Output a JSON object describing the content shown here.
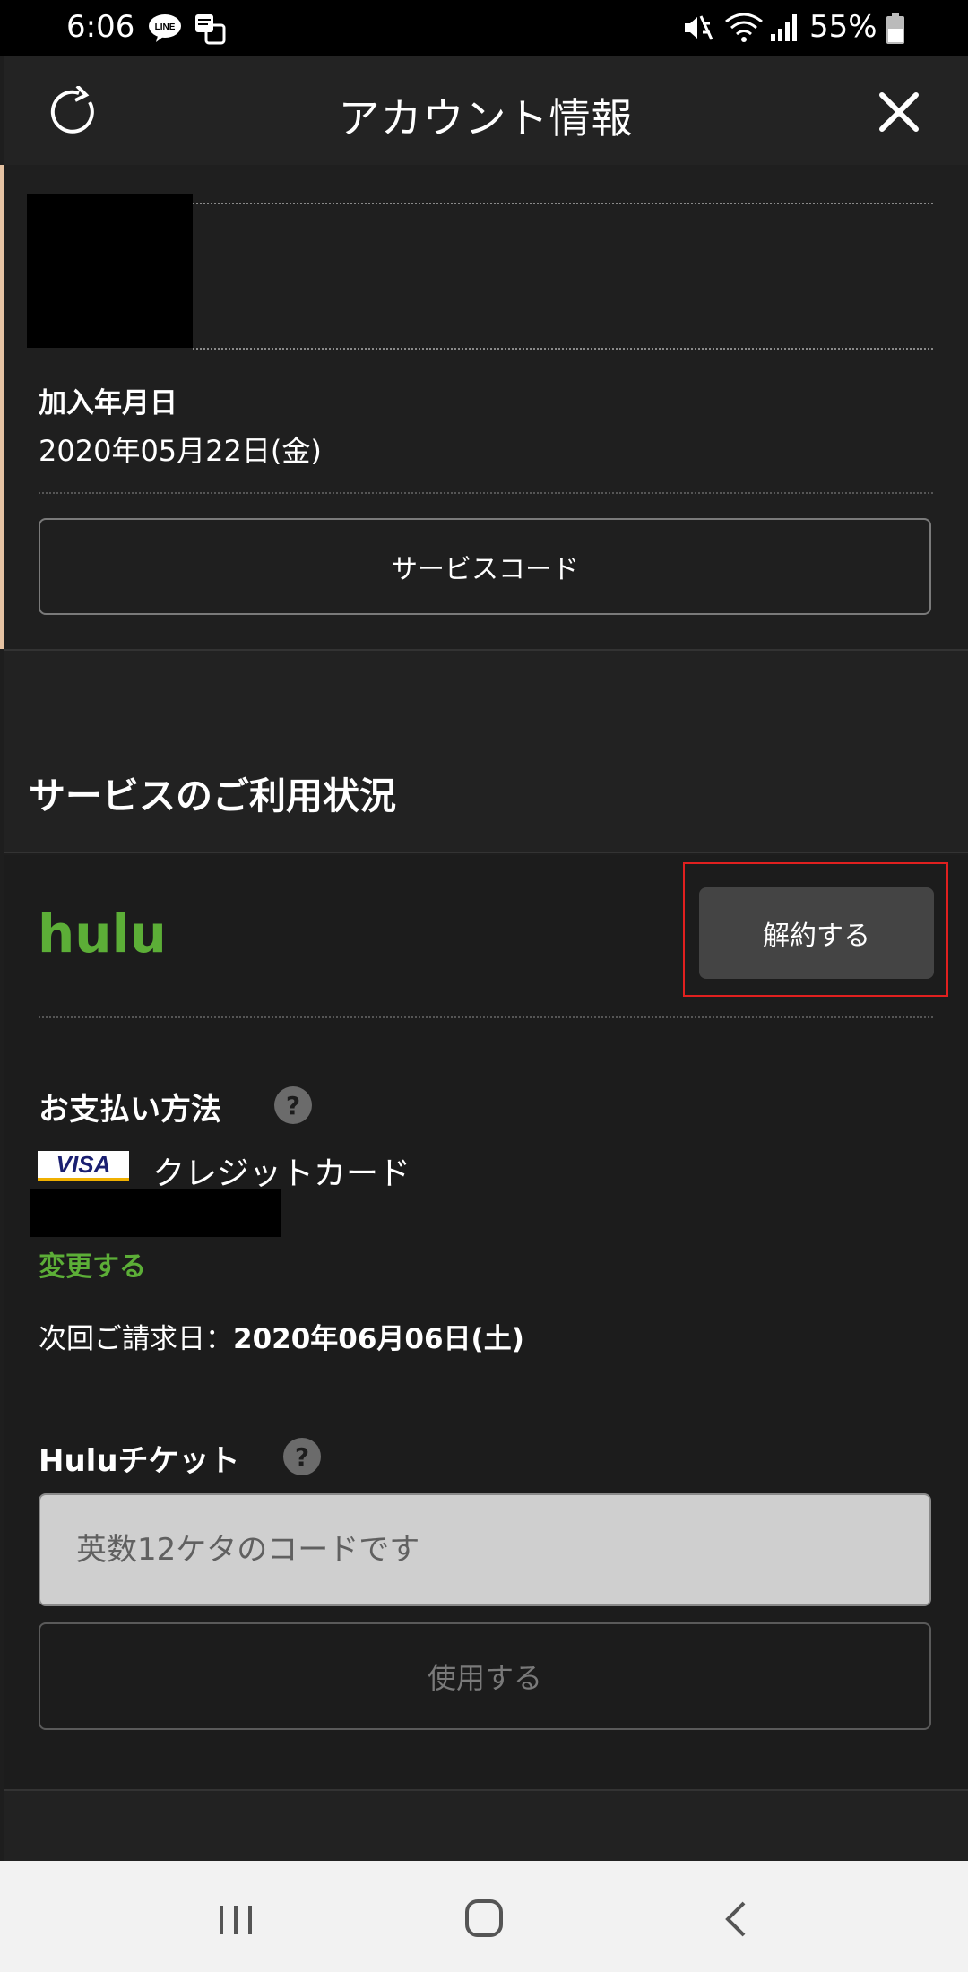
{
  "status_bar": {
    "time": "6:06",
    "icons": [
      "line-app-icon",
      "gallery-icon",
      "mute-vibrate-icon",
      "wifi-icon",
      "signal-icon",
      "battery-icon"
    ],
    "battery_percent": "55%"
  },
  "header": {
    "title": "アカウント情報",
    "refresh_icon": "refresh-icon",
    "close_icon": "close-icon"
  },
  "account": {
    "join_date_label": "加入年月日",
    "join_date_value": "2020年05月22日(金)",
    "service_code_button": "サービスコード"
  },
  "service_usage": {
    "section_title": "サービスのご利用状況",
    "service_logo_text": "hulu",
    "cancel_button": "解約する",
    "highlight_color": "#e0201f"
  },
  "payment": {
    "label": "お支払い方法",
    "help_glyph": "?",
    "card_brand": "VISA",
    "method": "クレジットカード",
    "change_link": "変更する",
    "next_billing_label": "次回ご請求日：",
    "next_billing_date": "2020年06月06日(土)"
  },
  "ticket": {
    "label": "Huluチケット",
    "help_glyph": "?",
    "input_placeholder": "英数12ケタのコードです",
    "use_button": "使用する"
  },
  "colors": {
    "background": "#1e1e1e",
    "hulu_green": "#5cae37",
    "button_gray": "#444444"
  },
  "nav_bar": {
    "icons": [
      "recents-icon",
      "home-icon",
      "back-icon"
    ]
  }
}
